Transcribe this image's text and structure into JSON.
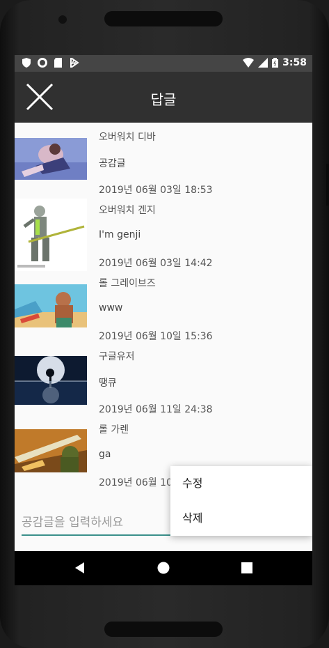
{
  "status_bar": {
    "time": "3:58",
    "left_icons": [
      "shield-icon",
      "circle-icon",
      "sd-card-icon",
      "flash-icon"
    ],
    "right_icons": [
      "wifi-icon",
      "signal-icon",
      "battery-icon"
    ]
  },
  "toolbar": {
    "title": "답글",
    "close_icon": "close-icon"
  },
  "replies": [
    {
      "name": "오버워치 디바",
      "content": "공감글",
      "date": "2019년 06월 03일 18:53"
    },
    {
      "name": "오버워치 겐지",
      "content": "I'm genji",
      "date": "2019년 06월 03일 14:42"
    },
    {
      "name": "롤 그레이브즈",
      "content": "www",
      "date": "2019년 06월 10일 15:36"
    },
    {
      "name": "구글유저",
      "content": "땡큐",
      "date": "2019년 06월 11일 24:38"
    },
    {
      "name": "롤 가렌",
      "content": "ga",
      "date": "2019년 06월 10"
    }
  ],
  "input": {
    "placeholder": "공감글을 입력하세요",
    "value": ""
  },
  "context_menu": {
    "edit_label": "수정",
    "delete_label": "삭제"
  },
  "nav": {
    "icons": [
      "back-icon",
      "home-icon",
      "recents-icon"
    ]
  },
  "colors": {
    "toolbar": "#303030",
    "status_bar": "#454545",
    "accent": "#3a8f8a"
  }
}
